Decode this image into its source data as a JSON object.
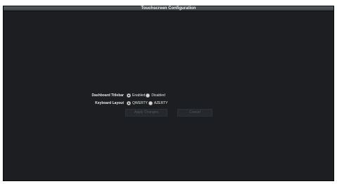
{
  "window": {
    "title": "Touchscreen Configuration"
  },
  "form": {
    "dashboard_titlebar": {
      "label": "Dashboard Titlebar",
      "options": [
        "Enabled",
        "Disabled"
      ],
      "selected": "Enabled"
    },
    "keyboard_layout": {
      "label": "Keyboard Layout",
      "options": [
        "QWERTY",
        "AZERTY"
      ],
      "selected": "QWERTY"
    }
  },
  "buttons": {
    "apply_label": "Apply Changes",
    "cancel_label": "Cancel"
  },
  "colors": {
    "background": "#1c1e21",
    "titlebar": "#4a4d51",
    "button_disabled_text": "#55585c"
  }
}
